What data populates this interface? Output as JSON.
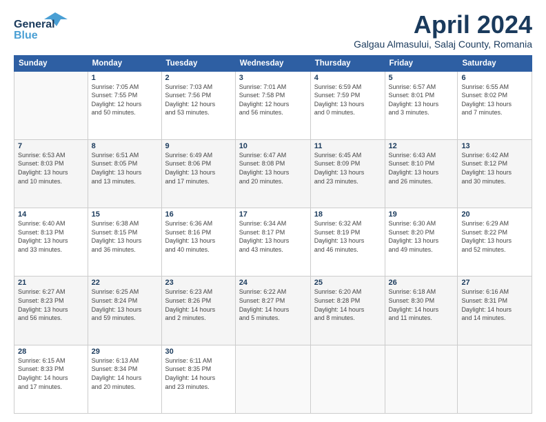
{
  "header": {
    "logo": {
      "general": "General",
      "blue": "Blue"
    },
    "title": "April 2024",
    "location": "Galgau Almasului, Salaj County, Romania"
  },
  "days": [
    "Sunday",
    "Monday",
    "Tuesday",
    "Wednesday",
    "Thursday",
    "Friday",
    "Saturday"
  ],
  "weeks": [
    [
      {
        "num": "",
        "text": ""
      },
      {
        "num": "1",
        "text": "Sunrise: 7:05 AM\nSunset: 7:55 PM\nDaylight: 12 hours\nand 50 minutes."
      },
      {
        "num": "2",
        "text": "Sunrise: 7:03 AM\nSunset: 7:56 PM\nDaylight: 12 hours\nand 53 minutes."
      },
      {
        "num": "3",
        "text": "Sunrise: 7:01 AM\nSunset: 7:58 PM\nDaylight: 12 hours\nand 56 minutes."
      },
      {
        "num": "4",
        "text": "Sunrise: 6:59 AM\nSunset: 7:59 PM\nDaylight: 13 hours\nand 0 minutes."
      },
      {
        "num": "5",
        "text": "Sunrise: 6:57 AM\nSunset: 8:01 PM\nDaylight: 13 hours\nand 3 minutes."
      },
      {
        "num": "6",
        "text": "Sunrise: 6:55 AM\nSunset: 8:02 PM\nDaylight: 13 hours\nand 7 minutes."
      }
    ],
    [
      {
        "num": "7",
        "text": "Sunrise: 6:53 AM\nSunset: 8:03 PM\nDaylight: 13 hours\nand 10 minutes."
      },
      {
        "num": "8",
        "text": "Sunrise: 6:51 AM\nSunset: 8:05 PM\nDaylight: 13 hours\nand 13 minutes."
      },
      {
        "num": "9",
        "text": "Sunrise: 6:49 AM\nSunset: 8:06 PM\nDaylight: 13 hours\nand 17 minutes."
      },
      {
        "num": "10",
        "text": "Sunrise: 6:47 AM\nSunset: 8:08 PM\nDaylight: 13 hours\nand 20 minutes."
      },
      {
        "num": "11",
        "text": "Sunrise: 6:45 AM\nSunset: 8:09 PM\nDaylight: 13 hours\nand 23 minutes."
      },
      {
        "num": "12",
        "text": "Sunrise: 6:43 AM\nSunset: 8:10 PM\nDaylight: 13 hours\nand 26 minutes."
      },
      {
        "num": "13",
        "text": "Sunrise: 6:42 AM\nSunset: 8:12 PM\nDaylight: 13 hours\nand 30 minutes."
      }
    ],
    [
      {
        "num": "14",
        "text": "Sunrise: 6:40 AM\nSunset: 8:13 PM\nDaylight: 13 hours\nand 33 minutes."
      },
      {
        "num": "15",
        "text": "Sunrise: 6:38 AM\nSunset: 8:15 PM\nDaylight: 13 hours\nand 36 minutes."
      },
      {
        "num": "16",
        "text": "Sunrise: 6:36 AM\nSunset: 8:16 PM\nDaylight: 13 hours\nand 40 minutes."
      },
      {
        "num": "17",
        "text": "Sunrise: 6:34 AM\nSunset: 8:17 PM\nDaylight: 13 hours\nand 43 minutes."
      },
      {
        "num": "18",
        "text": "Sunrise: 6:32 AM\nSunset: 8:19 PM\nDaylight: 13 hours\nand 46 minutes."
      },
      {
        "num": "19",
        "text": "Sunrise: 6:30 AM\nSunset: 8:20 PM\nDaylight: 13 hours\nand 49 minutes."
      },
      {
        "num": "20",
        "text": "Sunrise: 6:29 AM\nSunset: 8:22 PM\nDaylight: 13 hours\nand 52 minutes."
      }
    ],
    [
      {
        "num": "21",
        "text": "Sunrise: 6:27 AM\nSunset: 8:23 PM\nDaylight: 13 hours\nand 56 minutes."
      },
      {
        "num": "22",
        "text": "Sunrise: 6:25 AM\nSunset: 8:24 PM\nDaylight: 13 hours\nand 59 minutes."
      },
      {
        "num": "23",
        "text": "Sunrise: 6:23 AM\nSunset: 8:26 PM\nDaylight: 14 hours\nand 2 minutes."
      },
      {
        "num": "24",
        "text": "Sunrise: 6:22 AM\nSunset: 8:27 PM\nDaylight: 14 hours\nand 5 minutes."
      },
      {
        "num": "25",
        "text": "Sunrise: 6:20 AM\nSunset: 8:28 PM\nDaylight: 14 hours\nand 8 minutes."
      },
      {
        "num": "26",
        "text": "Sunrise: 6:18 AM\nSunset: 8:30 PM\nDaylight: 14 hours\nand 11 minutes."
      },
      {
        "num": "27",
        "text": "Sunrise: 6:16 AM\nSunset: 8:31 PM\nDaylight: 14 hours\nand 14 minutes."
      }
    ],
    [
      {
        "num": "28",
        "text": "Sunrise: 6:15 AM\nSunset: 8:33 PM\nDaylight: 14 hours\nand 17 minutes."
      },
      {
        "num": "29",
        "text": "Sunrise: 6:13 AM\nSunset: 8:34 PM\nDaylight: 14 hours\nand 20 minutes."
      },
      {
        "num": "30",
        "text": "Sunrise: 6:11 AM\nSunset: 8:35 PM\nDaylight: 14 hours\nand 23 minutes."
      },
      {
        "num": "",
        "text": ""
      },
      {
        "num": "",
        "text": ""
      },
      {
        "num": "",
        "text": ""
      },
      {
        "num": "",
        "text": ""
      }
    ]
  ]
}
